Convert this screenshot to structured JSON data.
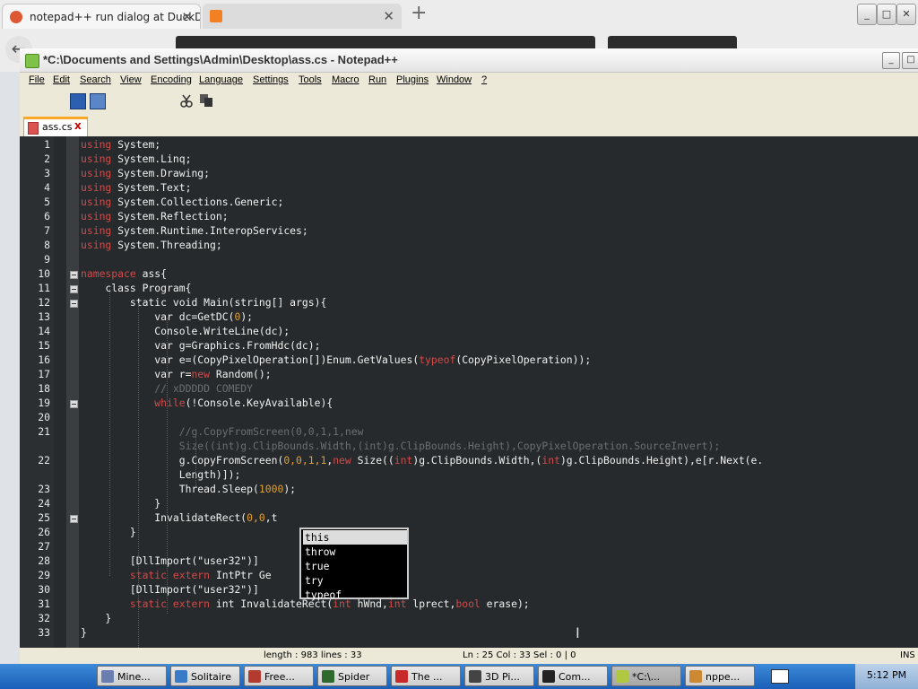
{
  "browser": {
    "tabs": [
      {
        "title": "notepad++ run dialog at DuckDuc",
        "close": "✕"
      },
      {
        "title": "",
        "close": "✕"
      }
    ],
    "new_tab": "+"
  },
  "window": {
    "title": "*C:\\Documents and Settings\\Admin\\Desktop\\ass.cs - Notepad++",
    "buttons": [
      "_",
      "□",
      "✕"
    ]
  },
  "menu": [
    "File",
    "Edit",
    "Search",
    "View",
    "Encoding",
    "Language",
    "Settings",
    "Tools",
    "Macro",
    "Run",
    "Plugins",
    "Window",
    "?"
  ],
  "doc_tab": {
    "name": "ass.cs",
    "close": "x"
  },
  "line_numbers": [
    "1",
    "2",
    "3",
    "4",
    "5",
    "6",
    "7",
    "8",
    "9",
    "10",
    "11",
    "12",
    "13",
    "14",
    "15",
    "16",
    "17",
    "18",
    "19",
    "20",
    "21",
    "",
    "22",
    "",
    "23",
    "24",
    "25",
    "26",
    "27",
    "28",
    "29",
    "30",
    "31",
    "32",
    "33"
  ],
  "code_lines": [
    [
      [
        "kw",
        "using"
      ],
      [
        "st",
        " System;"
      ]
    ],
    [
      [
        "kw",
        "using"
      ],
      [
        "st",
        " System.Linq;"
      ]
    ],
    [
      [
        "kw",
        "using"
      ],
      [
        "st",
        " System.Drawing;"
      ]
    ],
    [
      [
        "kw",
        "using"
      ],
      [
        "st",
        " System.Text;"
      ]
    ],
    [
      [
        "kw",
        "using"
      ],
      [
        "st",
        " System.Collections.Generic;"
      ]
    ],
    [
      [
        "kw",
        "using"
      ],
      [
        "st",
        " System.Reflection;"
      ]
    ],
    [
      [
        "kw",
        "using"
      ],
      [
        "st",
        " System.Runtime.InteropServices;"
      ]
    ],
    [
      [
        "kw",
        "using"
      ],
      [
        "st",
        " System.Threading;"
      ]
    ],
    [],
    [
      [
        "kw",
        "namespace"
      ],
      [
        "st",
        " ass{"
      ]
    ],
    [
      [
        "st",
        "    class Program{"
      ]
    ],
    [
      [
        "st",
        "        static void Main(string[] args){"
      ]
    ],
    [
      [
        "st",
        "            var dc=GetDC("
      ],
      [
        "nm",
        "0"
      ],
      [
        "st",
        ");"
      ]
    ],
    [
      [
        "st",
        "            Console.WriteLine(dc);"
      ]
    ],
    [
      [
        "st",
        "            var g=Graphics.FromHdc(dc);"
      ]
    ],
    [
      [
        "st",
        "            var e=(CopyPixelOperation[])Enum.GetValues("
      ],
      [
        "kw",
        "typeof"
      ],
      [
        "st",
        "(CopyPixelOperation));"
      ]
    ],
    [
      [
        "st",
        "            var r="
      ],
      [
        "kw",
        "new"
      ],
      [
        "st",
        " Random();"
      ]
    ],
    [
      [
        "cm",
        "            // xDDDDD COMEDY"
      ]
    ],
    [
      [
        "kw",
        "            while"
      ],
      [
        "st",
        "(!Console.KeyAvailable){"
      ]
    ],
    [],
    [
      [
        "cm",
        "                //g.CopyFromScreen(0,0,1,1,new"
      ]
    ],
    [
      [
        "cm",
        "                Size((int)g.ClipBounds.Width,(int)g.ClipBounds.Height),CopyPixelOperation.SourceInvert);"
      ]
    ],
    [
      [
        "st",
        "                g.CopyFromScreen("
      ],
      [
        "nm",
        "0,0,1,1"
      ],
      [
        "st",
        ","
      ],
      [
        "kw",
        "new"
      ],
      [
        "st",
        " Size(("
      ],
      [
        "kw",
        "int"
      ],
      [
        "st",
        ")g.ClipBounds.Width,("
      ],
      [
        "kw",
        "int"
      ],
      [
        "st",
        ")g.ClipBounds.Height),e[r.Next(e."
      ]
    ],
    [
      [
        "st",
        "                Length)]);"
      ]
    ],
    [
      [
        "st",
        "                Thread.Sleep("
      ],
      [
        "nm",
        "1000"
      ],
      [
        "st",
        ");"
      ]
    ],
    [
      [
        "st",
        "            }"
      ]
    ],
    [
      [
        "st",
        "            InvalidateRect("
      ],
      [
        "nm",
        "0,0"
      ],
      [
        "st",
        ",t"
      ]
    ],
    [
      [
        "st",
        "        }"
      ]
    ],
    [],
    [
      [
        "st",
        "        [DllImport(\"user32\")]"
      ]
    ],
    [
      [
        "kw",
        "        static extern"
      ],
      [
        "st",
        " IntPtr Ge"
      ]
    ],
    [
      [
        "st",
        "        [DllImport(\"user32\")]"
      ]
    ],
    [
      [
        "kw",
        "        static extern"
      ],
      [
        "st",
        " int InvalidateRect("
      ],
      [
        "kw",
        "int"
      ],
      [
        "st",
        " hWnd,"
      ],
      [
        "kw",
        "int"
      ],
      [
        "st",
        " lprect,"
      ],
      [
        "kw",
        "bool"
      ],
      [
        "st",
        " erase);"
      ]
    ],
    [
      [
        "st",
        "    }"
      ]
    ],
    [
      [
        "st",
        "}"
      ]
    ]
  ],
  "autocomplete": [
    "this",
    "throw",
    "true",
    "try",
    "typeof"
  ],
  "status": {
    "length": "length : 983    lines : 33",
    "pos": "Ln : 25    Col : 33    Sel : 0 | 0",
    "mode": "INS"
  },
  "taskbar": {
    "items": [
      "Mine...",
      "Solitaire",
      "Free...",
      "Spider",
      "The ...",
      "3D Pi...",
      "Com...",
      "*C:\\...",
      "nppe..."
    ],
    "clock": "5:12 PM"
  },
  "colors": {
    "editor_bg": "#262a2c",
    "keyword": "#d24a4a",
    "number": "#e0a030",
    "comment": "#6b6f72"
  }
}
